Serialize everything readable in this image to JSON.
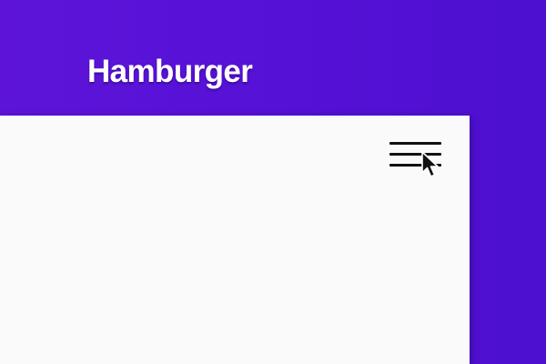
{
  "header": {
    "title": "Hamburger"
  },
  "menu": {
    "icon": "hamburger-menu-icon",
    "pointer_icon": "mouse-pointer-icon"
  },
  "colors": {
    "background": "#5b12d6",
    "panel": "#fafafa",
    "title": "#ffffff",
    "icon": "#111111"
  }
}
